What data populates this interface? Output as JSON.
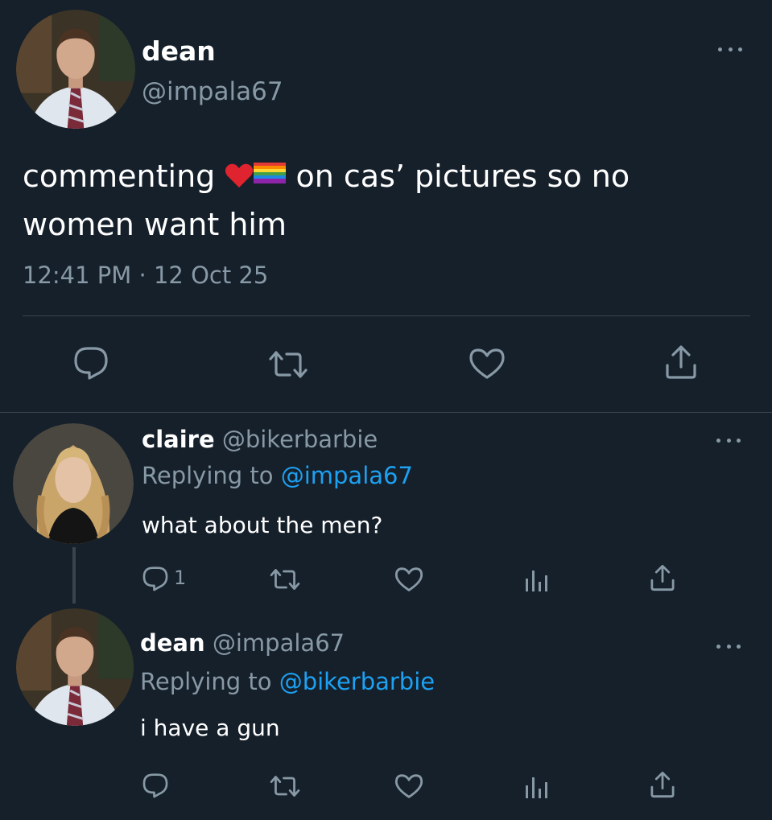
{
  "main_tweet": {
    "display_name": "dean",
    "handle": "@impala67",
    "text_before": "commenting",
    "emojis": [
      "red-heart",
      "rainbow-flag"
    ],
    "text_after_line1": "on cas’ pictures so no",
    "text_line2": "women want him",
    "timestamp": "12:41 PM · 12 Oct 25",
    "actions": [
      "reply-icon",
      "retweet-icon",
      "like-icon",
      "share-icon"
    ]
  },
  "replies": [
    {
      "display_name": "claire",
      "handle": "@bikerbarbie",
      "replying_to_label": "Replying to",
      "replying_to_handle": "@impala67",
      "text": "what about the men?",
      "reply_count": "1",
      "actions": [
        "reply-icon",
        "retweet-icon",
        "like-icon",
        "analytics-icon",
        "share-icon"
      ]
    },
    {
      "display_name": "dean",
      "handle": "@impala67",
      "replying_to_label": "Replying to",
      "replying_to_handle": "@bikerbarbie",
      "text": "i have a gun",
      "reply_count": "",
      "actions": [
        "reply-icon",
        "retweet-icon",
        "like-icon",
        "analytics-icon",
        "share-icon"
      ]
    }
  ],
  "colors": {
    "background": "#15202b",
    "muted": "#8899a6",
    "link": "#1da1f2",
    "divider": "#38444d"
  }
}
